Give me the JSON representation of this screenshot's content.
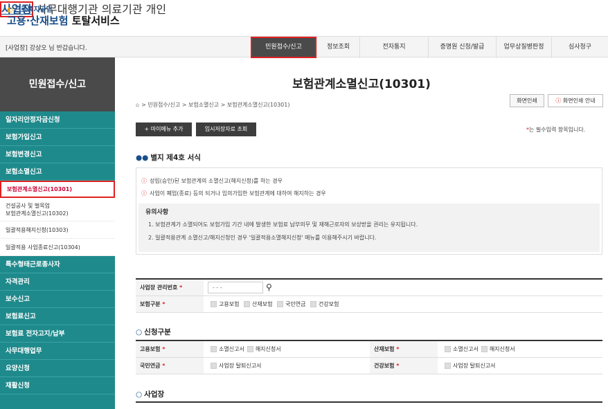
{
  "header": {
    "org": "근로복지공단",
    "service_a": "고용·산재보험",
    "service_b": "토탈서비스",
    "nav": [
      "사업장",
      "사무대행기관",
      "의료기관",
      "개인"
    ]
  },
  "bar": {
    "greeting": "[사업장] 강상오 님 반갑습니다.",
    "tabs": [
      "민원접수/신고",
      "정보조회",
      "전자통지",
      "증명원 신청/발급",
      "업무상질병판정",
      "심사청구"
    ]
  },
  "sidebar": {
    "title": "민원접수/신고",
    "items": [
      "일자리안정자금신청",
      "보험가입신고",
      "보험변경신고",
      "보험소멸신고"
    ],
    "subs": [
      "보험관계소멸신고(10301)",
      "건설공사 및 벌목업",
      "보험관계소멸신고(10302)",
      "일괄적용해지신청(10303)",
      "일괄적용 사업종료신고(10304)"
    ],
    "items2": [
      "특수형태근로종사자",
      "자격관리",
      "보수신고",
      "보험료신고",
      "보험료 전자고지/납부",
      "사무대행업무",
      "요양신청",
      "재활신청"
    ]
  },
  "page": {
    "title": "보험관계소멸신고(10301)",
    "breadcrumb": "> 민원접수/신고 > 보험소멸신고 > 보험관계소멸신고(10301)",
    "print": "화면인쇄",
    "print_guide": "화면인쇄 안내",
    "btn_menu": "+ 마이메뉴 추가",
    "btn_temp": "임시저장자료 조회",
    "required": "는 필수입력 항목입니다.",
    "form_title": "별지 제4호 서식"
  },
  "notice": {
    "line1": "성립(승인)된 보험관계의 소멸신고(해지신청)를 하는 경우",
    "line2": "사업이 폐업(종료) 등의 되거나 임의가입한 보험관계에 대하여 해지하는 경우",
    "caution": "유의사항",
    "c1": "1. 보험관계가 소멸되어도 보험가입 기간 내에 발생한 보험료 납부의무 및 재해근로자의 보상받을 권리는 유지됩니다.",
    "c2": "2. 일괄적용관계 소멸신고/해지신청인 경우 '일괄적용소멸해지신청' 메뉴를 이용해주시기 바랍니다."
  },
  "form": {
    "mgmt_label": "사업장 관리번호",
    "mgmt_value": "-  -  -",
    "ins_label": "보험구분",
    "ins_opts": [
      "고용보험",
      "산재보험",
      "국민연금",
      "건강보험"
    ],
    "apply_title": "신청구분",
    "emp_label": "고용보험",
    "emp_opts": [
      "소멸신고서",
      "해지신청서"
    ],
    "ind_label": "산재보험",
    "ind_opts": [
      "소멸신고서",
      "해지신청서"
    ],
    "pen_label": "국민연금",
    "pen_opt": "사업장 탈퇴신고서",
    "hlt_label": "건강보험",
    "hlt_opt": "사업장 탈퇴신고서",
    "biz_title": "사업장"
  }
}
